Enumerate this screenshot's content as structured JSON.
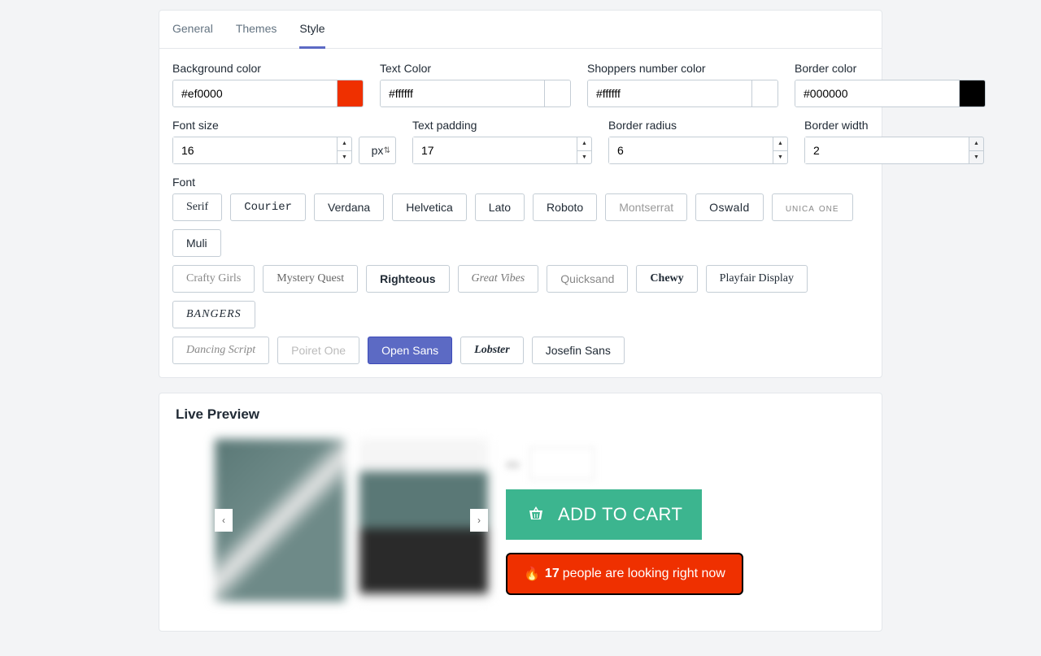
{
  "tabs": {
    "general": "General",
    "themes": "Themes",
    "style": "Style"
  },
  "labels": {
    "bgcolor": "Background color",
    "textcolor": "Text Color",
    "numcolor": "Shoppers number color",
    "bordercolor": "Border color",
    "fontsize": "Font size",
    "textpadding": "Text padding",
    "borderradius": "Border radius",
    "borderwidth": "Border width",
    "font": "Font"
  },
  "values": {
    "bgcolor": "#ef0000",
    "textcolor": "#ffffff",
    "numcolor": "#ffffff",
    "bordercolor": "#000000",
    "fontsize": "16",
    "fontunit": "px",
    "textpadding": "17",
    "borderradius": "6",
    "borderwidth": "2"
  },
  "colors": {
    "bgcolor": "#ef3000",
    "textcolor": "#ffffff",
    "numcolor": "#ffffff",
    "bordercolor": "#000000"
  },
  "fonts": {
    "serif": "Serif",
    "courier": "Courier",
    "verdana": "Verdana",
    "helvetica": "Helvetica",
    "lato": "Lato",
    "roboto": "Roboto",
    "montserrat": "Montserrat",
    "oswald": "Oswald",
    "unica": "unica one",
    "muli": "Muli",
    "crafty": "Crafty Girls",
    "mystery": "Mystery Quest",
    "righteous": "Righteous",
    "greatvibes": "Great Vibes",
    "quicksand": "Quicksand",
    "chewy": "Chewy",
    "playfair": "Playfair Display",
    "bangers": "BANGERS",
    "dancing": "Dancing Script",
    "poiret": "Poiret One",
    "opensans": "Open Sans",
    "lobster": "Lobster",
    "josefin": "Josefin Sans"
  },
  "preview": {
    "title": "Live Preview",
    "qty": "qty",
    "addToCart": "ADD TO CART",
    "fire": "🔥",
    "shoppers": "17",
    "shoptext": "people are looking right now"
  }
}
